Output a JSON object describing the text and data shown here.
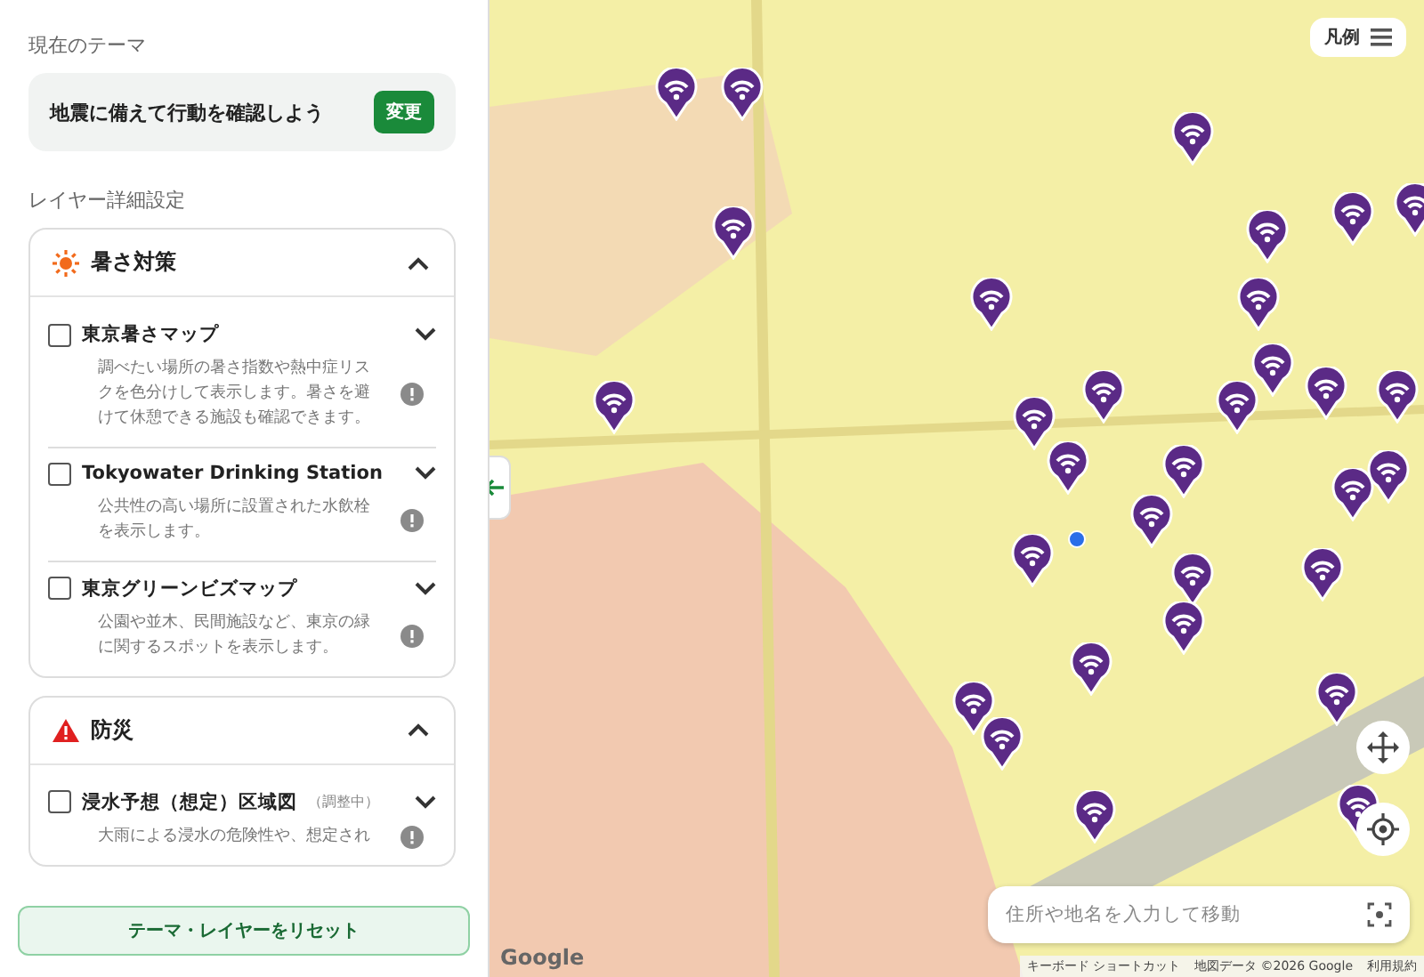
{
  "current_theme": {
    "label": "現在のテーマ",
    "title": "地震に備えて行動を確認しよう",
    "button": "変更"
  },
  "layer_settings": {
    "label": "レイヤー詳細設定",
    "groups": [
      {
        "kind": "heat",
        "title": "暑さ対策",
        "expanded": true,
        "layers": [
          {
            "name": "東京暑さマップ",
            "checked": false,
            "expanded": false,
            "description": "調べたい場所の暑さ指数や熱中症リスクを色分けして表示します。暑さを避けて休憩できる施設も確認できます。"
          },
          {
            "name": "Tokyowater Drinking Station",
            "checked": false,
            "expanded": false,
            "description": "公共性の高い場所に設置された水飲栓を表示します。"
          },
          {
            "name": "東京グリーンビズマップ",
            "checked": false,
            "expanded": false,
            "description": "公園や並木、民間施設など、東京の緑に関するスポットを表示します。"
          }
        ]
      },
      {
        "kind": "disaster",
        "title": "防災",
        "expanded": true,
        "layers": [
          {
            "name": "浸水予想（想定）区域図",
            "note": "（調整中）",
            "checked": false,
            "expanded": false,
            "description": "大雨による浸水の危険性や、想定され"
          }
        ]
      }
    ]
  },
  "reset_button": "テーマ・レイヤーをリセット",
  "map": {
    "legend_button": "凡例",
    "search": {
      "placeholder": "住所や地名を入力して移動"
    },
    "logo": "Google",
    "footer": [
      "キーボード ショートカット",
      "地図データ ©2026 Google",
      "利用規約"
    ]
  }
}
